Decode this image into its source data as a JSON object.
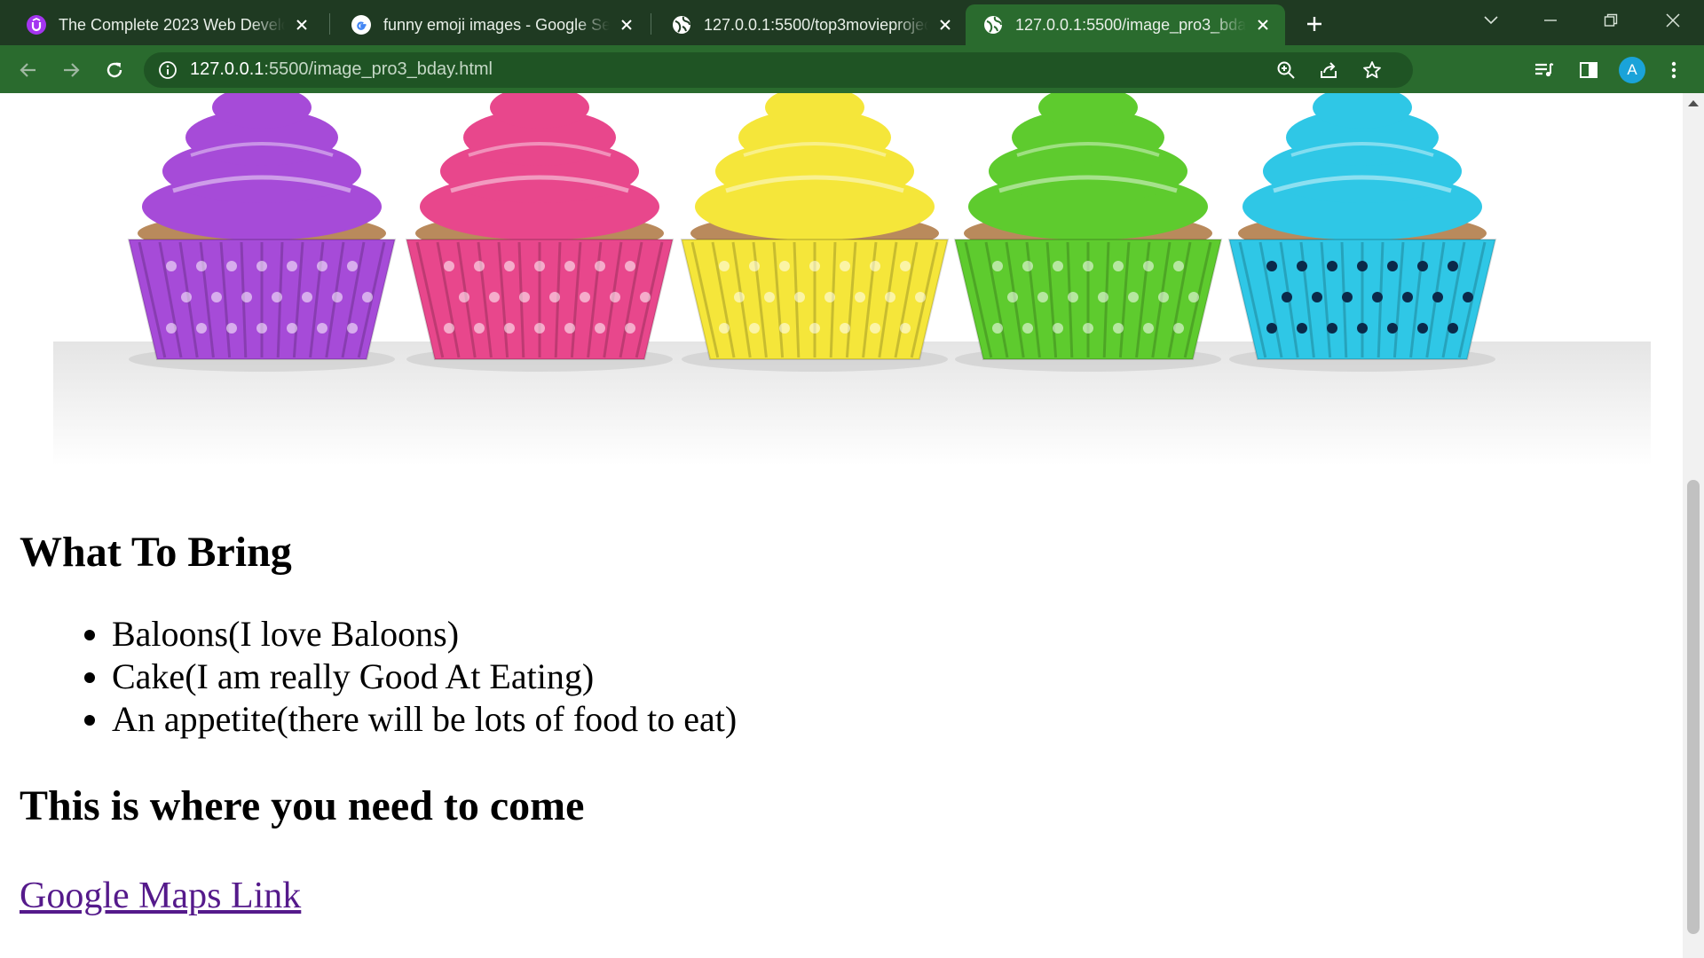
{
  "browser": {
    "tabs": [
      {
        "title": "The Complete 2023 Web Develop",
        "icon": "udemy-icon",
        "active": false
      },
      {
        "title": "funny emoji images - Google Sea",
        "icon": "google-icon",
        "active": false
      },
      {
        "title": "127.0.0.1:5500/top3movieproject",
        "icon": "globe-icon",
        "active": false
      },
      {
        "title": "127.0.0.1:5500/image_pro3_bday",
        "icon": "globe-icon",
        "active": true
      }
    ],
    "url_host": "127.0.0.1",
    "url_rest": ":5500/image_pro3_bday.html",
    "profile_initial": "A",
    "colors": {
      "tabbar": "#1f3a22",
      "toolbar": "#2a6b2e",
      "omnibox": "#1f5424"
    }
  },
  "page": {
    "hero_image": {
      "subject": "five cupcakes in a row",
      "colors": [
        "#a64bd8",
        "#e8478c",
        "#f5e63a",
        "#5ecb2e",
        "#2fc7e6"
      ]
    },
    "heading_bring": "What To Bring",
    "bring_items": [
      "Baloons(I love Baloons)",
      "Cake(I am really Good At Eating)",
      "An appetite(there will be lots of food to eat)"
    ],
    "heading_location": "This is where you need to come",
    "map_link": "Google Maps Link"
  }
}
